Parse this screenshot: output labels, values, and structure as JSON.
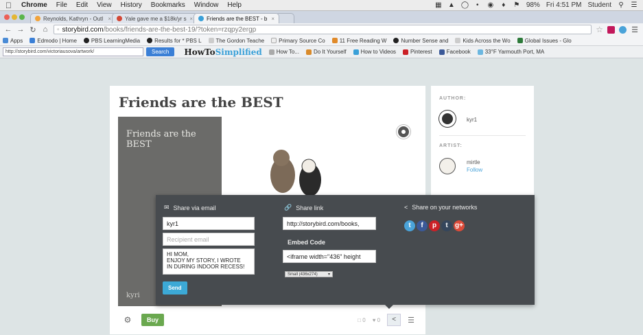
{
  "menubar": {
    "app": "Chrome",
    "items": [
      "File",
      "Edit",
      "View",
      "History",
      "Bookmarks",
      "Window",
      "Help"
    ],
    "battery": "98%",
    "clock": "Fri 4:51 PM",
    "user": "Student"
  },
  "tabs": [
    {
      "label": "Reynolds, Kathryn - Outl",
      "color": "#f2a33a"
    },
    {
      "label": "Yale gave me a $18k/yr s",
      "color": "#d34836"
    },
    {
      "label": "Friends are the BEST - b",
      "color": "#3aa0d8"
    }
  ],
  "address": {
    "host": "storybird.com",
    "path": "/books/friends-are-the-best-19/?token=rzqpy2ergp"
  },
  "bookmarks": [
    {
      "label": "Apps",
      "color": "#4a8bd6"
    },
    {
      "label": "Edmodo | Home",
      "color": "#3b7fd6"
    },
    {
      "label": "PBS LearningMedia",
      "color": "#222222"
    },
    {
      "label": "Results for * PBS L",
      "color": "#222222"
    },
    {
      "label": "The Gordon Teache",
      "color": "#cccccc"
    },
    {
      "label": "Primary Source Co",
      "color": "#eeeeee"
    },
    {
      "label": "11 Free Reading W",
      "color": "#e08a2a"
    },
    {
      "label": "Number Sense and",
      "color": "#222222"
    },
    {
      "label": "Kids Across the Wo",
      "color": "#cccccc"
    },
    {
      "label": "Global Issues - Glo",
      "color": "#2d7a3a"
    }
  ],
  "toolbar2": {
    "url_field": "http://storybird.com/victoriausova/artwork/",
    "search_label": "Search",
    "logo_a": "HowTo",
    "logo_b": "Simplified",
    "items": [
      "How To...",
      "Do It Yourself",
      "How to Videos",
      "Pinterest",
      "Facebook",
      "33°F Yarmouth Port, MA"
    ]
  },
  "book": {
    "title": "Friends are the BEST",
    "cover_title": "Friends are the BEST",
    "cover_author": "kyri",
    "buy_label": "Buy",
    "stat_a": "0",
    "stat_b": "0"
  },
  "sidebar": {
    "author_label": "AUTHOR:",
    "author_name": "kyr1",
    "artist_label": "ARTIST:",
    "artist_name": "mirtle",
    "follow_label": "Follow"
  },
  "share": {
    "email_head": "Share via email",
    "from_value": "kyr1",
    "recipient_placeholder": "Recipient email",
    "message": "HI MOM,\nENJOY MY STORY, I WROTE\nIN DURING INDOOR RECESS!",
    "send_label": "Send",
    "link_head": "Share link",
    "link_value": "http://storybird.com/books,",
    "embed_head": "Embed Code",
    "embed_value": "<iframe width=\"436\" height",
    "size_option": "Small (436x274)",
    "networks_head": "Share on your networks",
    "networks": [
      {
        "name": "twitter-icon",
        "glyph": "t",
        "color": "#4aa3d9"
      },
      {
        "name": "facebook-icon",
        "glyph": "f",
        "color": "#3b5998"
      },
      {
        "name": "pinterest-icon",
        "glyph": "p",
        "color": "#cb2027"
      },
      {
        "name": "tumblr-icon",
        "glyph": "t",
        "color": "#35465c"
      },
      {
        "name": "google-plus-icon",
        "glyph": "g+",
        "color": "#dd4b39"
      }
    ]
  }
}
